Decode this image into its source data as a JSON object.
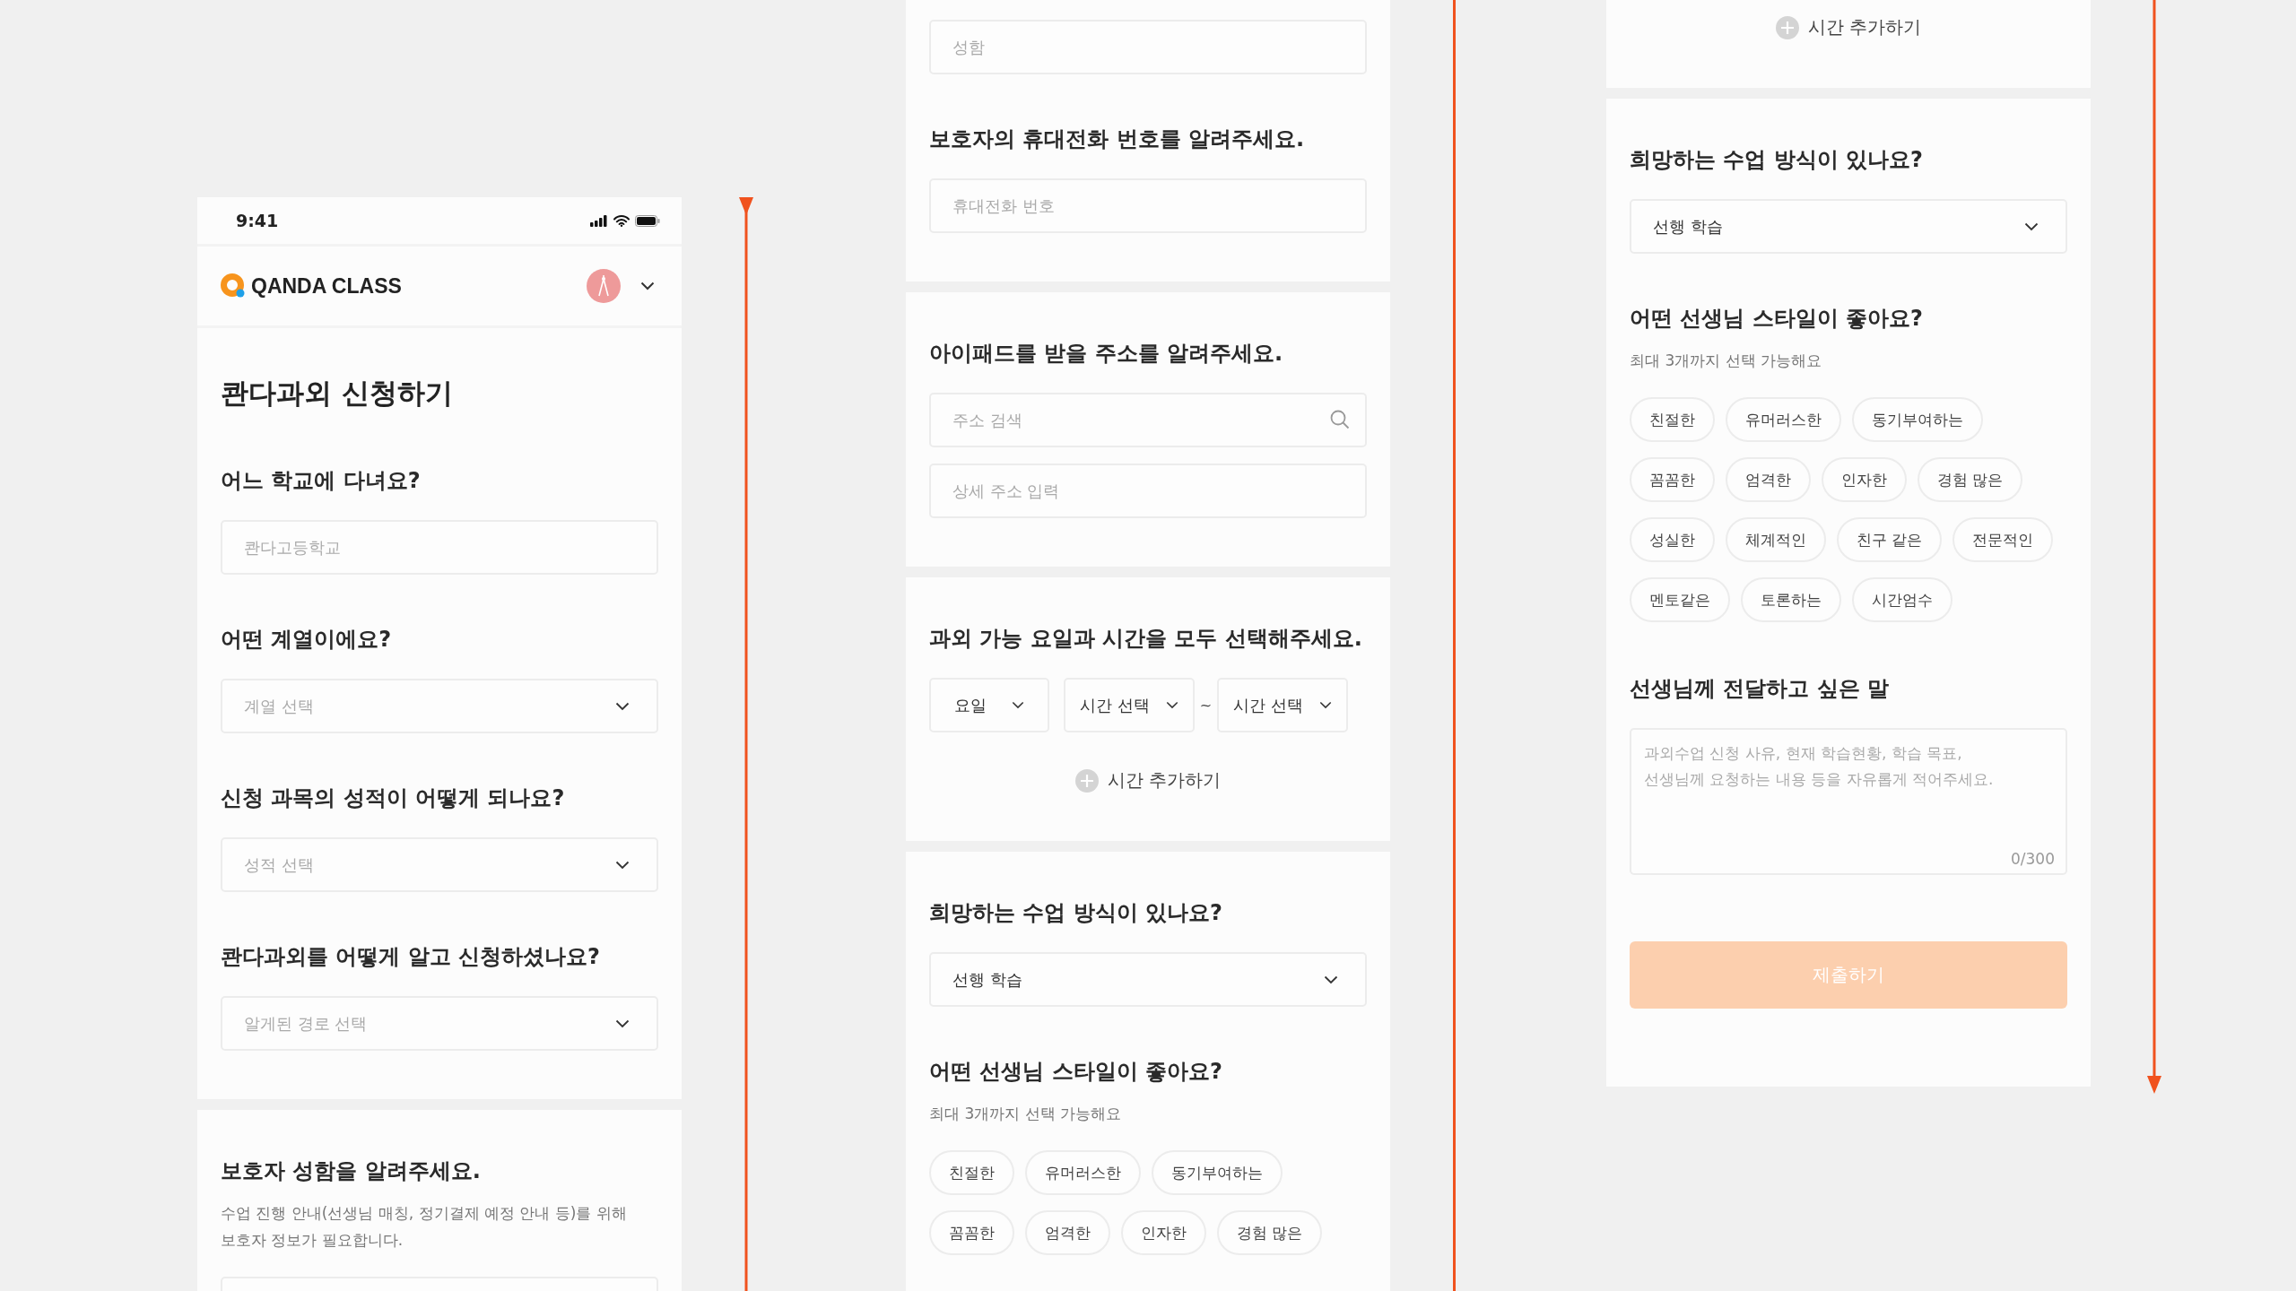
{
  "panels": [
    {
      "status_bar": {
        "time": "9:41"
      },
      "header": {
        "brand": "QANDA CLASS"
      },
      "cards": [
        {
          "blocks": [
            {
              "kind": "title",
              "text": "콴다과외 신청하기"
            },
            {
              "kind": "question",
              "text": "어느 학교에 다녀요?"
            },
            {
              "kind": "text_field",
              "placeholder": "콴다고등학교"
            },
            {
              "kind": "question",
              "text": "어떤 계열이에요?"
            },
            {
              "kind": "select",
              "placeholder": "계열 선택"
            },
            {
              "kind": "question",
              "text": "신청 과목의 성적이 어떻게 되나요?"
            },
            {
              "kind": "select",
              "placeholder": "성적 선택"
            },
            {
              "kind": "question",
              "text": "콴다과외를 어떻게 알고 신청하셨나요?"
            },
            {
              "kind": "select",
              "placeholder": "알게된 경로 선택"
            }
          ]
        },
        {
          "blocks": [
            {
              "kind": "question",
              "text": "보호자 성함을 알려주세요."
            },
            {
              "kind": "hint",
              "text": "수업 진행 안내(선생님 매칭, 정기결제 예정 안내 등)를 위해 보호자 정보가 필요합니다."
            },
            {
              "kind": "text_field"
            }
          ]
        }
      ]
    },
    {
      "cards": [
        {
          "blocks": [
            {
              "kind": "text_field",
              "placeholder": "성함"
            },
            {
              "kind": "question",
              "text": "보호자의 휴대전화 번호를 알려주세요."
            },
            {
              "kind": "text_field",
              "placeholder": "휴대전화 번호"
            }
          ]
        },
        {
          "blocks": [
            {
              "kind": "question",
              "text": "아이패드를 받을 주소를 알려주세요."
            },
            {
              "kind": "search_field",
              "placeholder": "주소 검색"
            },
            {
              "kind": "text_field",
              "placeholder": "상세 주소 입력"
            }
          ]
        },
        {
          "blocks": [
            {
              "kind": "question",
              "text": "과외 가능 요일과 시간을 모두 선택해주세요."
            },
            {
              "kind": "time_row",
              "day": "요일",
              "start": "시간 선택",
              "separator": "~",
              "end": "시간 선택"
            },
            {
              "kind": "add_time",
              "text": "시간 추가하기"
            }
          ]
        },
        {
          "blocks": [
            {
              "kind": "question",
              "text": "희망하는 수업 방식이 있나요?"
            },
            {
              "kind": "select",
              "value": "선행 학습"
            },
            {
              "kind": "question",
              "text": "어떤 선생님 스타일이 좋아요?"
            },
            {
              "kind": "hint",
              "text": "최대 3개까지 선택 가능해요"
            },
            {
              "kind": "chips",
              "items": [
                {
                  "label": "친절한",
                  "selected": false
                },
                {
                  "label": "유머러스한",
                  "selected": false
                },
                {
                  "label": "동기부여하는",
                  "selected": false
                },
                {
                  "label": "꼼꼼한",
                  "selected": false
                },
                {
                  "label": "엄격한",
                  "selected": false
                },
                {
                  "label": "인자한",
                  "selected": false
                },
                {
                  "label": "경험 많은",
                  "selected": false
                }
              ]
            }
          ]
        }
      ]
    },
    {
      "cards": [
        {
          "blocks": [
            {
              "kind": "add_time",
              "text": "시간 추가하기"
            }
          ]
        },
        {
          "blocks": [
            {
              "kind": "question",
              "text": "희망하는 수업 방식이 있나요?"
            },
            {
              "kind": "select",
              "value": "선행 학습"
            },
            {
              "kind": "question",
              "text": "어떤 선생님 스타일이 좋아요?"
            },
            {
              "kind": "hint",
              "text": "최대 3개까지 선택 가능해요"
            },
            {
              "kind": "chips",
              "items": [
                {
                  "label": "친절한",
                  "selected": false
                },
                {
                  "label": "유머러스한",
                  "selected": false
                },
                {
                  "label": "동기부여하는",
                  "selected": false
                },
                {
                  "label": "꼼꼼한",
                  "selected": false
                },
                {
                  "label": "엄격한",
                  "selected": false
                },
                {
                  "label": "인자한",
                  "selected": false
                },
                {
                  "label": "경험 많은",
                  "selected": false
                },
                {
                  "label": "성실한",
                  "selected": false
                },
                {
                  "label": "체계적인",
                  "selected": false
                },
                {
                  "label": "친구 같은",
                  "selected": false
                },
                {
                  "label": "전문적인",
                  "selected": false
                },
                {
                  "label": "멘토같은",
                  "selected": false
                },
                {
                  "label": "토론하는",
                  "selected": false
                },
                {
                  "label": "시간엄수",
                  "selected": false
                }
              ]
            },
            {
              "kind": "question",
              "text": "선생님께 전달하고 싶은 말"
            },
            {
              "kind": "textarea",
              "placeholder": "과외수업 신청 사유, 현재 학습현황, 학습 목표, 선생님께 요청하는 내용 등을 자유롭게 적어주세요.",
              "counter": "0/300"
            },
            {
              "kind": "submit",
              "text": "제출하기",
              "disabled": true
            }
          ]
        }
      ]
    }
  ]
}
